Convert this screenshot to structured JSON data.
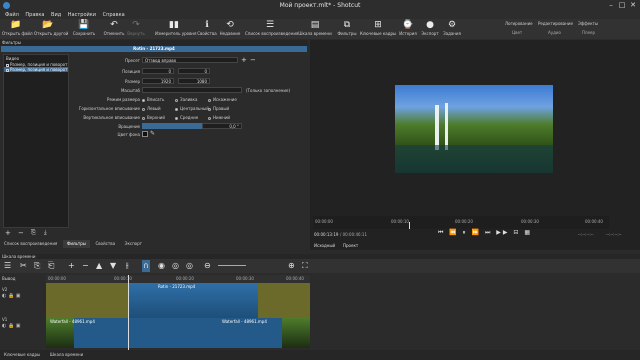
{
  "window": {
    "title": "Мой проект.mlt* - Shotcut"
  },
  "menu": [
    "Файл",
    "Правка",
    "Вид",
    "Настройки",
    "Справка"
  ],
  "toolbar": [
    {
      "icon": "folder-open-icon",
      "glyph": "📁",
      "label": "Открыть файл"
    },
    {
      "icon": "folder-other-icon",
      "glyph": "📂",
      "label": "Открыть другой"
    },
    {
      "icon": "save-icon",
      "glyph": "💾",
      "label": "Сохранить"
    },
    {
      "icon": "undo-icon",
      "glyph": "↶",
      "label": "Отменить"
    },
    {
      "icon": "redo-icon",
      "glyph": "↷",
      "label": "Вернуть",
      "disabled": true
    },
    {
      "icon": "peak-meter-icon",
      "glyph": "▮▮",
      "label": "Измеритель уровня"
    },
    {
      "icon": "properties-icon",
      "glyph": "ℹ",
      "label": "Свойства"
    },
    {
      "icon": "recent-icon",
      "glyph": "⟲",
      "label": "Недавние"
    },
    {
      "icon": "playlist-icon",
      "glyph": "☰",
      "label": "Список воспроизведения"
    },
    {
      "icon": "timeline-icon",
      "glyph": "▤",
      "label": "Шкала времени"
    },
    {
      "icon": "filters-icon",
      "glyph": "⧉",
      "label": "Фильтры"
    },
    {
      "icon": "keyframes-icon",
      "glyph": "⊞",
      "label": "Ключевые кадры"
    },
    {
      "icon": "history-icon",
      "glyph": "⌚",
      "label": "История"
    },
    {
      "icon": "export-icon",
      "glyph": "●",
      "label": "Экспорт"
    },
    {
      "icon": "jobs-icon",
      "glyph": "⚙",
      "label": "Задания"
    }
  ],
  "layouts": {
    "top": [
      "Логирование",
      "Редактирование",
      "Эффекты"
    ],
    "sub": [
      "Цвет",
      "Аудио",
      "Плеер"
    ]
  },
  "filters": {
    "header": "Фильтры",
    "clip_name": "Rotin - 21723.mp4",
    "list_title": "Видео",
    "items": [
      "Размер, позиция и поворот",
      "Размер, позиция и поворот"
    ],
    "preset_label": "Пресет",
    "preset_value": "Отзвод вправо",
    "position_label": "Позиция",
    "position_x": "0",
    "position_y": "0",
    "size_label": "Размер",
    "size_w": "1920",
    "size_h": "1080",
    "scale_label": "Масштаб",
    "scale_note": "(Только заполнение)",
    "size_mode_label": "Режим размера",
    "size_mode_options": [
      "Вписать",
      "Заливка",
      "Искажение"
    ],
    "halign_label": "Горизонтальное вписывание",
    "halign_options": [
      "Левый",
      "Центральный",
      "Правый"
    ],
    "valign_label": "Вертикальное вписывание",
    "valign_options": [
      "Верхний",
      "Средние",
      "Нижний"
    ],
    "rotation_label": "Вращение",
    "rotation_value": "0,0 °",
    "bg_color_label": "Цвет фона",
    "list_buttons": [
      "+",
      "−",
      "⎘",
      "⤓"
    ]
  },
  "bottom_tabs": [
    "Список воспроизведения",
    "Фильтры",
    "Свойства",
    "Экспорт"
  ],
  "player": {
    "timecode": "00:00:13:19",
    "duration": "/ 00:00:46:11",
    "ruler": [
      "00:00:00",
      "00:00:10",
      "00:00:20",
      "00:00:30",
      "00:00:40"
    ],
    "tabs": [
      "Исходный",
      "Проект"
    ],
    "dash1": "--:--:--:--",
    "dash2": "--:--:--:--"
  },
  "timeline": {
    "header": "Шкала времени",
    "output_label": "Вывод",
    "tracks": [
      {
        "name": "V2",
        "clip": "Rotin - 21723.mp4"
      },
      {
        "name": "V1",
        "clip": "Waterfall - 48961.mp4",
        "clip2": "Waterfall - 48961.mp4"
      }
    ],
    "ruler": [
      "00:00:00",
      "00:00:10",
      "00:00:20",
      "00:00:30",
      "00:00:40"
    ]
  },
  "status": [
    "Ключевые кадры",
    "Шкала времени"
  ]
}
